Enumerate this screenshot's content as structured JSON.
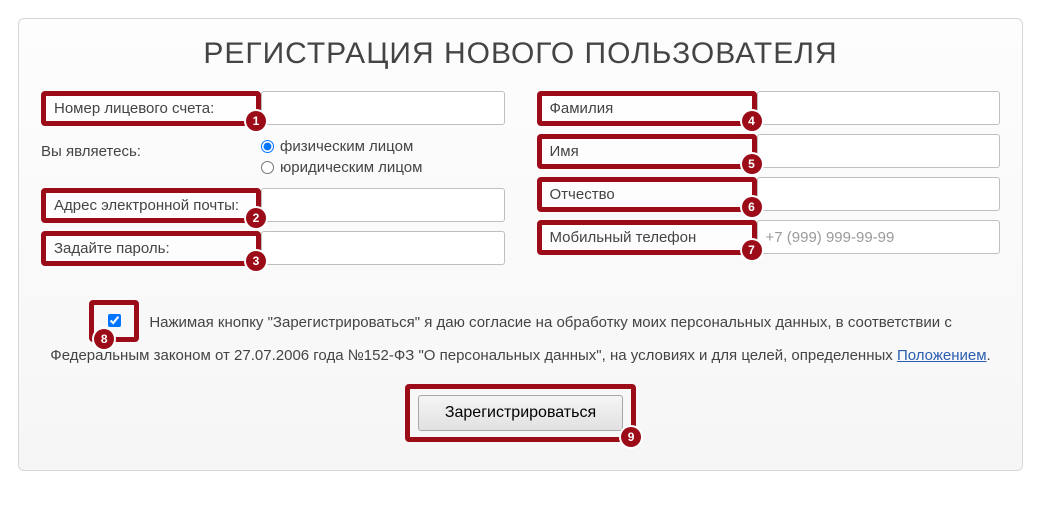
{
  "title": "РЕГИСТРАЦИЯ НОВОГО ПОЛЬЗОВАТЕЛЯ",
  "left": {
    "account_label": "Номер лицевого счета:",
    "you_are_label": "Вы являетесь:",
    "radio_individual": "физическим лицом",
    "radio_legal": "юридическим лицом",
    "email_label": "Адрес электронной почты:",
    "password_label": "Задайте пароль:"
  },
  "right": {
    "lastname_label": "Фамилия",
    "firstname_label": "Имя",
    "middlename_label": "Отчество",
    "phone_label": "Мобильный телефон",
    "phone_placeholder": "+7 (999) 999-99-99"
  },
  "consent": {
    "pre": "Нажимая кнопку \"Зарегистрироваться\" я даю согласие на обработку моих персональных данных, в соответствии с Федеральным законом от 27.07.2006 года №152-ФЗ \"О персональных данных\", на условиях и для целей, определенных ",
    "link": "Положением",
    "post": "."
  },
  "submit_label": "Зарегистрироваться",
  "badges": {
    "b1": "1",
    "b2": "2",
    "b3": "3",
    "b4": "4",
    "b5": "5",
    "b6": "6",
    "b7": "7",
    "b8": "8",
    "b9": "9"
  }
}
